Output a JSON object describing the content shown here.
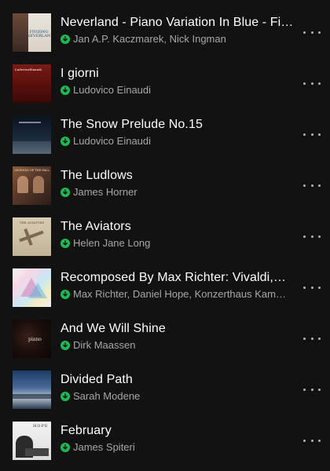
{
  "tracks": [
    {
      "title": "Neverland - Piano Variation In Blue - Fi…",
      "artist": "Jan A.P. Kaczmarek, Nick Ingman",
      "art_text": "FINDING NEVERLAND",
      "downloaded": true
    },
    {
      "title": "I giorni",
      "artist": "Ludovico Einaudi",
      "art_text": "LudovicoEinaudi",
      "downloaded": true
    },
    {
      "title": "The Snow Prelude No.15",
      "artist": "Ludovico Einaudi",
      "art_text": "",
      "downloaded": true
    },
    {
      "title": "The Ludlows",
      "artist": "James Horner",
      "art_text": "LEGENDS OF THE FALL",
      "downloaded": true
    },
    {
      "title": "The Aviators",
      "artist": "Helen Jane Long",
      "art_text": "THE AVIATORS",
      "downloaded": true
    },
    {
      "title": "Recomposed By Max Richter: Vivaldi,…",
      "artist": "Max Richter, Daniel Hope, Konzerthaus Kam…",
      "art_text": "",
      "downloaded": true
    },
    {
      "title": "And We Will Shine",
      "artist": "Dirk Maassen",
      "art_text": "piano",
      "downloaded": true
    },
    {
      "title": "Divided Path",
      "artist": "Sarah Modene",
      "art_text": "",
      "downloaded": true
    },
    {
      "title": "February",
      "artist": "James Spiteri",
      "art_text": "HOPE",
      "downloaded": true
    }
  ],
  "colors": {
    "background": "#121212",
    "title": "#ffffff",
    "artist": "#a7a7a7",
    "download_badge": "#1db954",
    "more_dots": "#b3b3b3"
  },
  "icons": {
    "download": "download-icon",
    "more": "more-options-icon"
  }
}
